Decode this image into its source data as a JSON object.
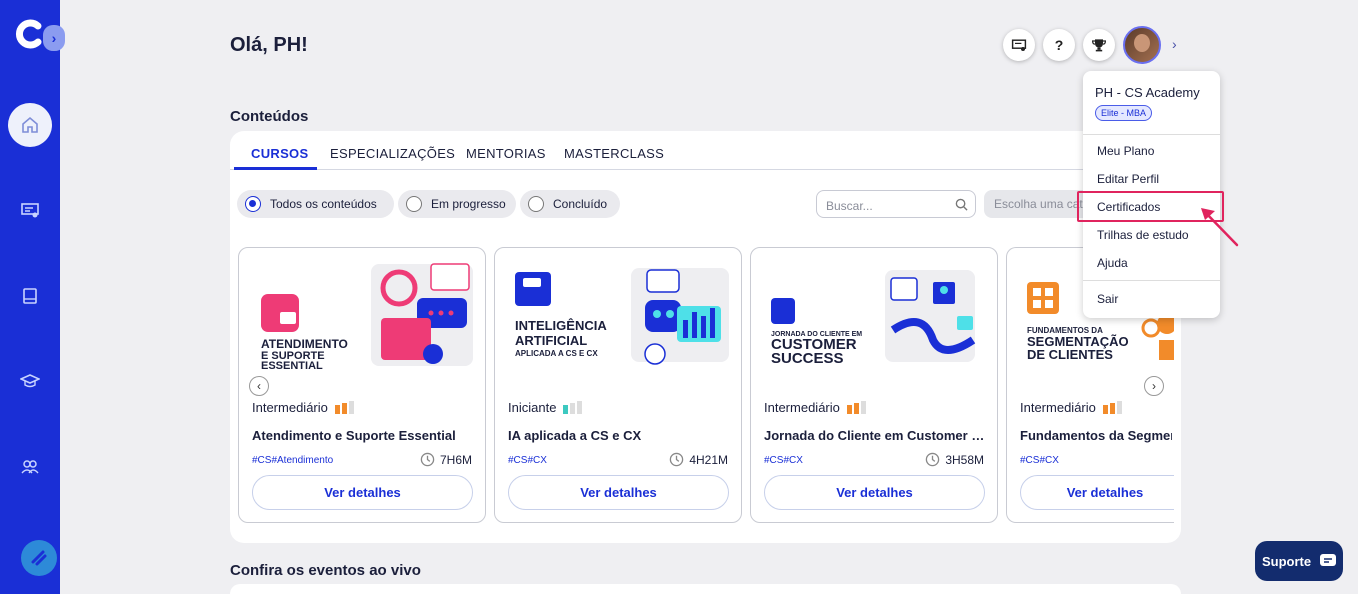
{
  "header": {
    "greeting": "Olá, PH!"
  },
  "contents": {
    "title": "Conteúdos",
    "tabs": [
      {
        "label": "CURSOS",
        "active": true
      },
      {
        "label": "ESPECIALIZAÇÕES",
        "active": false
      },
      {
        "label": "MENTORIAS",
        "active": false
      },
      {
        "label": "MASTERCLASS",
        "active": false
      }
    ],
    "filters": [
      {
        "label": "Todos os conteúdos",
        "selected": true
      },
      {
        "label": "Em progresso",
        "selected": false
      },
      {
        "label": "Concluído",
        "selected": false
      }
    ],
    "search_placeholder": "Buscar...",
    "select_placeholder": "Escolha uma categoria",
    "courses": [
      {
        "thumb_text": [
          "ATENDIMENTO",
          "E SUPORTE",
          "ESSENTIAL"
        ],
        "level": "Intermediário",
        "title": "Atendimento e Suporte Essential",
        "tags": "#CS#Atendimento",
        "duration": "7H6M",
        "button": "Ver detalhes",
        "level_color": "#f28b2a",
        "level_value": 2
      },
      {
        "thumb_text": [
          "INTELIGÊNCIA",
          "ARTIFICIAL",
          "APLICADA A CS E CX"
        ],
        "level": "Iniciante",
        "title": "IA aplicada a CS e CX",
        "tags": "#CS#CX",
        "duration": "4H21M",
        "button": "Ver detalhes",
        "level_color": "#3cc9c0",
        "level_value": 1
      },
      {
        "thumb_text": [
          "JORNADA DO CLIENTE EM",
          "CUSTOMER",
          "SUCCESS"
        ],
        "level": "Intermediário",
        "title": "Jornada do Cliente em Customer Success",
        "tags": "#CS#CX",
        "duration": "3H58M",
        "button": "Ver detalhes",
        "level_color": "#f28b2a",
        "level_value": 2
      },
      {
        "thumb_text": [
          "FUNDAMENTOS DA",
          "SEGMENTAÇÃO",
          "DE CLIENTES"
        ],
        "level": "Intermediário",
        "title": "Fundamentos da Segmentação de Clientes",
        "tags": "#CS#CX",
        "duration": "",
        "button": "Ver detalhes",
        "level_color": "#f28b2a",
        "level_value": 2
      }
    ]
  },
  "events": {
    "title": "Confira os eventos ao vivo"
  },
  "user_menu": {
    "name": "PH - CS Academy",
    "plan_badge": "Elite - MBA",
    "items": [
      "Meu Plano",
      "Editar Perfil",
      "Certificados",
      "Trilhas de estudo",
      "Ajuda"
    ],
    "logout": "Sair",
    "highlighted": "Certificados"
  },
  "support": {
    "label": "Suporte"
  },
  "colors": {
    "brand": "#1a2fd6",
    "highlight": "#e0245e",
    "support_bg": "#132c6e"
  }
}
